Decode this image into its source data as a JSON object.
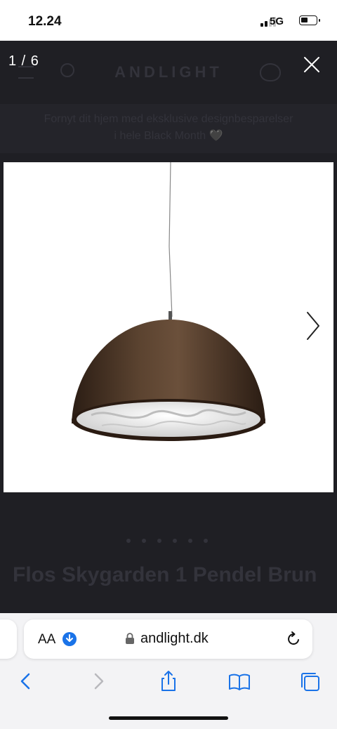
{
  "status_bar": {
    "time": "12.24",
    "network": "5G"
  },
  "viewer": {
    "counter": "1 / 6",
    "icons": {
      "close": "close-icon",
      "prev": "chevron-left-icon",
      "next": "chevron-right-icon"
    }
  },
  "background_page": {
    "logo": "ANDLIGHT",
    "promo_line1": "Fornyt dit hjem med eksklusive designbesparelser",
    "promo_line2": "i hele Black Month 🖤",
    "product_title": "Flos Skygarden 1 Pendel Brun"
  },
  "browser": {
    "text_size_label": "AA",
    "url": "andlight.dk",
    "accent_color": "#1a73e8",
    "icons": [
      "download-icon",
      "lock-icon",
      "reload-icon",
      "back-icon",
      "forward-icon",
      "share-icon",
      "bookmarks-icon",
      "tabs-icon"
    ]
  }
}
